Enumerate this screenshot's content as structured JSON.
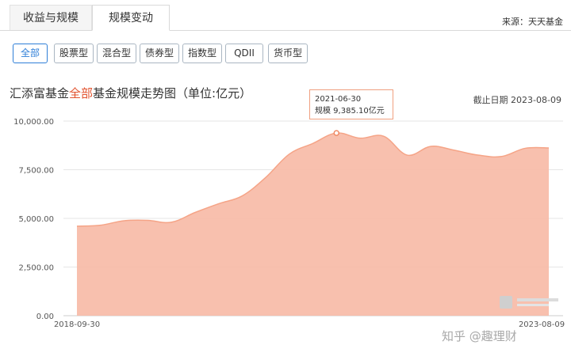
{
  "tabs": [
    {
      "label": "收益与规模",
      "active": false
    },
    {
      "label": "规模变动",
      "active": true
    }
  ],
  "source": "来源：天天基金",
  "filters": [
    {
      "label": "全部",
      "selected": true
    },
    {
      "label": "股票型",
      "selected": false
    },
    {
      "label": "混合型",
      "selected": false
    },
    {
      "label": "债券型",
      "selected": false
    },
    {
      "label": "指数型",
      "selected": false
    },
    {
      "label": "QDII",
      "selected": false
    },
    {
      "label": "货币型",
      "selected": false
    }
  ],
  "title": {
    "prefix": "汇添富基金",
    "highlight": "全部",
    "suffix": "基金规模走势图（单位:亿元）"
  },
  "cutoff_date": "截止日期 2023-08-09",
  "tooltip": {
    "date": "2021-06-30",
    "value_text": "规模 9,385.10亿元"
  },
  "watermark": "知乎 @趣理财",
  "colors": {
    "area_fill": "#f7b9a5",
    "area_line": "#f5a487",
    "tab_selected": "#2f7fd8",
    "title_highlight": "#e2532f",
    "grid": "#e6e6e6"
  },
  "chart_data": {
    "type": "area",
    "title": "汇添富基金全部基金规模走势图（单位:亿元）",
    "x_labels_shown": [
      "2018-09-30",
      "2023-08-09"
    ],
    "x": [
      "2018-09-30",
      "2018-12-31",
      "2019-03-31",
      "2019-06-30",
      "2019-09-30",
      "2019-12-31",
      "2020-03-31",
      "2020-06-30",
      "2020-09-30",
      "2020-12-31",
      "2021-03-31",
      "2021-06-30",
      "2021-09-30",
      "2021-12-31",
      "2022-03-31",
      "2022-06-30",
      "2022-09-30",
      "2022-12-31",
      "2023-03-31",
      "2023-06-30",
      "2023-08-09"
    ],
    "values": [
      4600,
      4650,
      4880,
      4900,
      4800,
      5300,
      5750,
      6150,
      7100,
      8300,
      8850,
      9385.1,
      9120,
      9220,
      8250,
      8700,
      8500,
      8250,
      8180,
      8600,
      8620
    ],
    "yticks": [
      0,
      2500,
      5000,
      7500,
      10000
    ],
    "ytick_labels": [
      "0.00",
      "2,500.00",
      "5,000.00",
      "7,500.00",
      "10,000.00"
    ],
    "ylim": [
      0,
      10000
    ],
    "grid": true,
    "highlight": {
      "x": "2021-06-30",
      "value": 9385.1
    }
  }
}
